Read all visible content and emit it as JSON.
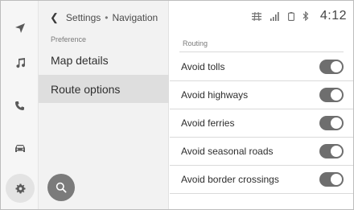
{
  "breadcrumb": {
    "parent": "Settings",
    "separator": "•",
    "current": "Navigation"
  },
  "rail": {
    "items": [
      {
        "icon": "navigation-arrow-icon"
      },
      {
        "icon": "music-note-icon"
      },
      {
        "icon": "phone-icon"
      },
      {
        "icon": "car-icon"
      },
      {
        "icon": "gear-icon",
        "active": true
      }
    ]
  },
  "menu": {
    "section_label": "Preference",
    "items": [
      {
        "label": "Map details",
        "selected": false
      },
      {
        "label": "Route options",
        "selected": true
      }
    ]
  },
  "status_bar": {
    "icons": [
      "traffic-icon",
      "signal-bars-icon",
      "phone-battery-icon",
      "bluetooth-icon"
    ],
    "time": "4:12"
  },
  "routing": {
    "section_label": "Routing",
    "options": [
      {
        "label": "Avoid tolls",
        "enabled": true
      },
      {
        "label": "Avoid highways",
        "enabled": true
      },
      {
        "label": "Avoid ferries",
        "enabled": true
      },
      {
        "label": "Avoid seasonal roads",
        "enabled": true
      },
      {
        "label": "Avoid border crossings",
        "enabled": true
      }
    ]
  },
  "colors": {
    "toggle_on": "#6e6e6e",
    "panel": "#f2f2f2",
    "selected": "#dedede",
    "fab": "#7b7b7b"
  }
}
